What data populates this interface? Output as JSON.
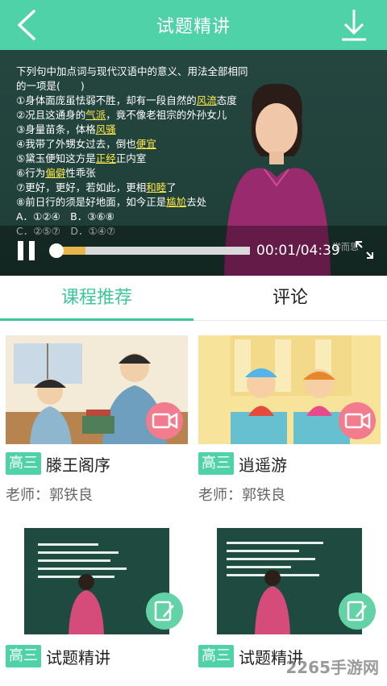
{
  "header": {
    "title": "试题精讲",
    "back_icon": "back-arrow-icon",
    "download_icon": "download-icon"
  },
  "video": {
    "lines": [
      [
        "下列句中加点词与现代汉语中的意义、用法全部相同",
        ""
      ],
      [
        "的一项是(　　)",
        ""
      ],
      [
        "①身体面庞虽怯弱不胜，却有一段自然的",
        "风流",
        "态度"
      ],
      [
        "②况且这通身的",
        "气派",
        "，竟不像老祖宗的外孙女儿"
      ],
      [
        "③身量苗条，体格",
        "风骚",
        ""
      ],
      [
        "④我带了外甥女过去，倒也",
        "便宜",
        ""
      ],
      [
        "⑤黛玉便知这方是",
        "正经",
        "正内室"
      ],
      [
        "⑥行为",
        "偏僻",
        "性乖张"
      ],
      [
        "⑦更好，更好，若如此，更相",
        "和睦",
        "了"
      ],
      [
        "⑧前日行的须是好地面，如今正是",
        "尴尬",
        "去处"
      ],
      [
        "A．①②④　B．③⑥⑧",
        ""
      ],
      [
        "C．②⑤⑦　D．①④⑦",
        ""
      ]
    ],
    "time": "00:01/04:39",
    "progress": 0.15,
    "watermark": "学而思"
  },
  "tabs": [
    {
      "label": "课程推荐",
      "active": true
    },
    {
      "label": "评论",
      "active": false
    }
  ],
  "courses": [
    {
      "grade": "高三",
      "title": "滕王阁序",
      "teacher": "老师：郭铁良",
      "badge": "video-camera-icon"
    },
    {
      "grade": "高三",
      "title": "逍遥游",
      "teacher": "老师：郭铁良",
      "badge": "video-camera-icon"
    },
    {
      "grade": "高三",
      "title": "试题精讲",
      "teacher": "",
      "badge": "edit-icon"
    },
    {
      "grade": "高三",
      "title": "试题精讲",
      "teacher": "",
      "badge": "edit-icon"
    }
  ],
  "site_logo": "2265手游网",
  "colors": {
    "accent": "#4fd2a7",
    "tab_active": "#3cc79a",
    "camera_badge": "#f27c8e"
  }
}
